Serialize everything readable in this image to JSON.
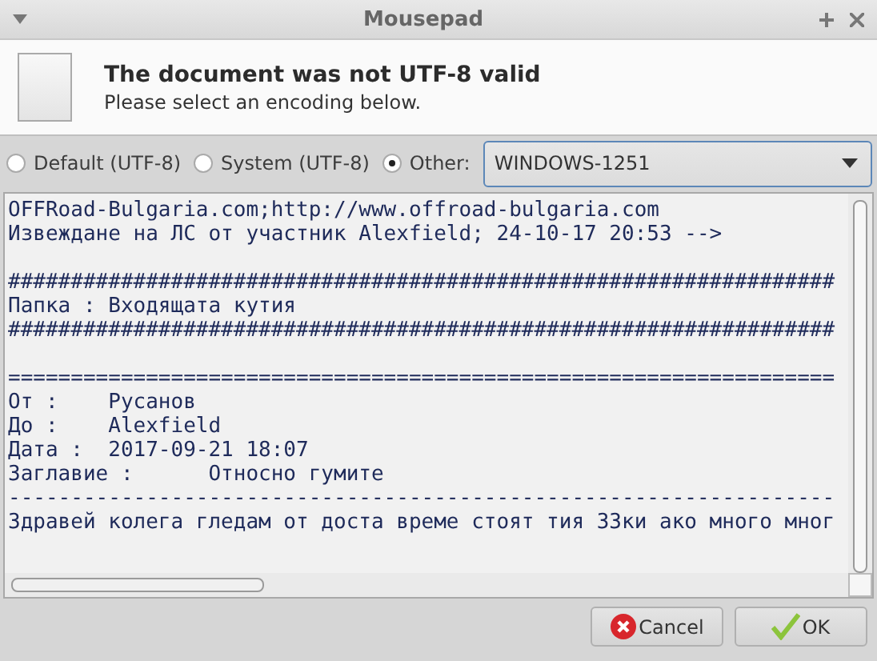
{
  "window": {
    "title": "Mousepad"
  },
  "info": {
    "heading": "The document was not UTF-8 valid",
    "message": "Please select an encoding below."
  },
  "encodings": [
    {
      "label": "Default (UTF-8)",
      "selected": false
    },
    {
      "label": "System (UTF-8)",
      "selected": false
    },
    {
      "label": "Other:",
      "selected": true
    }
  ],
  "encoding_select": {
    "value": "WINDOWS-1251"
  },
  "document_paragraphs": [
    [
      "OFFRoad-Bulgaria.com;http://www.offroad-bulgaria.com",
      "Извеждане на ЛС от участник Alexfield; 24-10-17 20:53 -->"
    ],
    [
      "##################################################################",
      "Папка : Входящата кутия",
      "##################################################################"
    ],
    [
      "==================================================================",
      "От :    Русанов",
      "До :    Alexfield",
      "Дата :  2017-09-21 18:07",
      "Заглавие :      Относно гумите",
      "------------------------------------------------------------------",
      "Здравей колега гледам от доста време стоят тия 33ки ако много мног"
    ]
  ],
  "buttons": [
    {
      "kind": "cancel",
      "label": "Cancel"
    },
    {
      "kind": "ok",
      "label": "OK"
    }
  ]
}
